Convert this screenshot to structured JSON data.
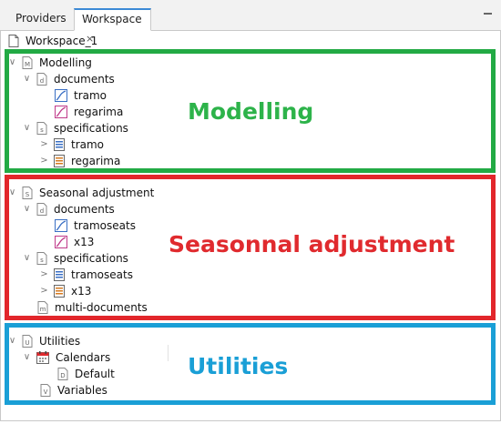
{
  "tabs": [
    {
      "label": "Providers",
      "active": false
    },
    {
      "label": "Workspace",
      "active": true,
      "close": "×"
    }
  ],
  "workspace": {
    "label": "Workspace_1"
  },
  "tree": {
    "modelling": {
      "label": "Modelling",
      "documents": {
        "label": "documents",
        "items": [
          "tramo",
          "regarima"
        ]
      },
      "specifications": {
        "label": "specifications",
        "items": [
          "tramo",
          "regarima"
        ]
      }
    },
    "sa": {
      "label": "Seasonal adjustment",
      "documents": {
        "label": "documents",
        "items": [
          "tramoseats",
          "x13"
        ]
      },
      "specifications": {
        "label": "specifications",
        "items": [
          "tramoseats",
          "x13"
        ]
      },
      "multi": {
        "label": "multi-documents"
      }
    },
    "utilities": {
      "label": "Utilities",
      "calendars": {
        "label": "Calendars",
        "items": [
          "Default"
        ]
      },
      "variables": {
        "label": "Variables"
      }
    }
  },
  "annotations": {
    "modelling": "Modelling",
    "sa": "Seasonnal adjustment",
    "utilities": "Utilities"
  },
  "icons": {
    "folder_letters": {
      "modelling": "M",
      "documents": "d",
      "specifications": "s",
      "sa": "S",
      "multi": "m",
      "utilities": "U",
      "variables": "V",
      "default": "D"
    }
  },
  "colors": {
    "green": "#22aa44",
    "red": "#e2262b",
    "blue": "#1a9fd6",
    "tab_accent": "#3c8ad6"
  }
}
